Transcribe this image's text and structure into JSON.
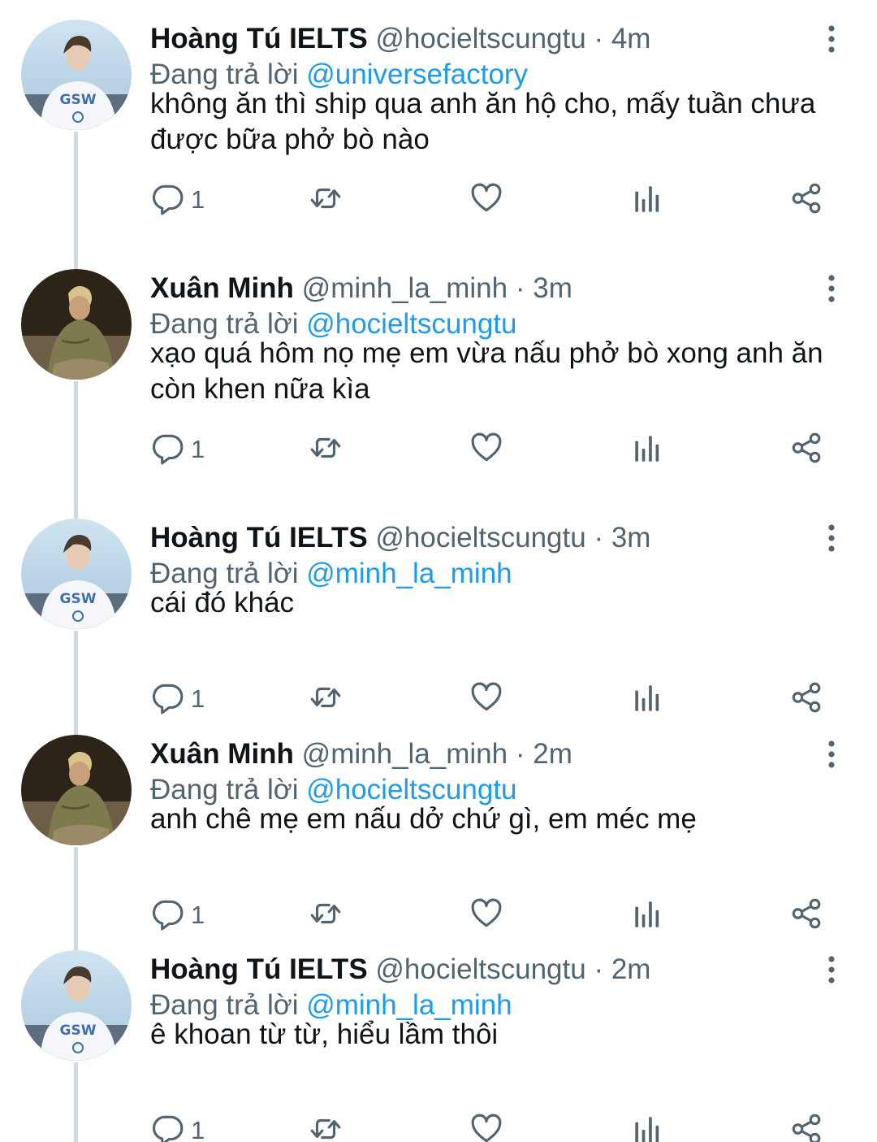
{
  "labels": {
    "replying_to": "Đang trả lời",
    "separator": "·"
  },
  "colors": {
    "accent": "#1d9bf0",
    "text": "#0f1419",
    "secondary": "#536471",
    "thread_line": "#cfd9de"
  },
  "tweets": [
    {
      "avatar": "avatar-gsw",
      "name": "Hoàng Tú IELTS",
      "handle": "@hocieltscungtu",
      "time": "4m",
      "reply_to": "@universefactory",
      "text_lines": [
        "không ăn thì ship qua anh ăn hộ cho, mấy tuần chưa",
        "được bữa phở bò nào"
      ],
      "reply_count": "1"
    },
    {
      "avatar": "avatar-minh",
      "name": "Xuân Minh",
      "handle": "@minh_la_minh",
      "time": "3m",
      "reply_to": "@hocieltscungtu",
      "text_lines": [
        "xạo quá hôm nọ mẹ em vừa nấu phở bò xong anh ăn",
        "còn khen nữa kìa"
      ],
      "reply_count": "1"
    },
    {
      "avatar": "avatar-gsw",
      "name": "Hoàng Tú IELTS",
      "handle": "@hocieltscungtu",
      "time": "3m",
      "reply_to": "@minh_la_minh",
      "text_lines": [
        "cái đó khác"
      ],
      "reply_count": "1"
    },
    {
      "avatar": "avatar-minh",
      "name": "Xuân Minh",
      "handle": "@minh_la_minh",
      "time": "2m",
      "reply_to": "@hocieltscungtu",
      "text_lines": [
        "anh chê mẹ em nấu dở chứ gì, em méc mẹ"
      ],
      "reply_count": "1"
    },
    {
      "avatar": "avatar-gsw",
      "name": "Hoàng Tú IELTS",
      "handle": "@hocieltscungtu",
      "time": "2m",
      "reply_to": "@minh_la_minh",
      "text_lines": [
        "ê khoan từ từ, hiểu lầm thôi"
      ],
      "reply_count": "1"
    }
  ],
  "actions": {
    "reply_icon": "reply-icon",
    "retweet_icon": "retweet-icon",
    "like_icon": "like-icon",
    "analytics_icon": "analytics-icon",
    "share_icon": "share-icon",
    "more_icon": "more-vertical-icon"
  }
}
